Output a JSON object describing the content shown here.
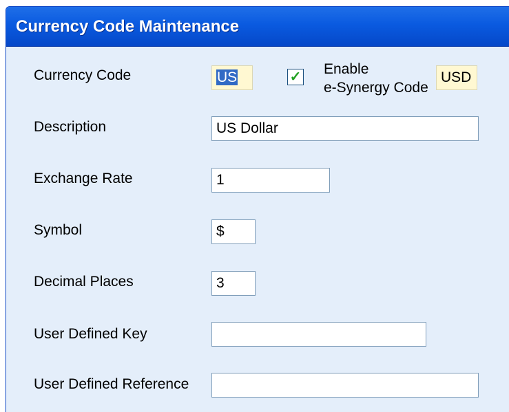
{
  "window": {
    "title": "Currency Code Maintenance"
  },
  "form": {
    "currency_code": {
      "label": "Currency Code",
      "value": "US"
    },
    "enable_esynergy": {
      "label_line1": "Enable",
      "label_line2": "e-Synergy Code",
      "checked": true,
      "check_glyph": "✓",
      "code": "USD"
    },
    "description": {
      "label": "Description",
      "value": "US Dollar"
    },
    "exchange_rate": {
      "label": "Exchange Rate",
      "value": "1"
    },
    "symbol": {
      "label": "Symbol",
      "value": "$"
    },
    "decimal_places": {
      "label": "Decimal Places",
      "value": "3"
    },
    "user_defined_key": {
      "label": "User Defined Key",
      "value": ""
    },
    "user_defined_reference": {
      "label": "User Defined Reference",
      "value": ""
    }
  },
  "colors": {
    "title_bar": "#0a5ae0",
    "panel_background": "#e4eefa",
    "readonly_field": "#fff8d2",
    "selection": "#316ac5",
    "check_mark": "#21a121"
  }
}
